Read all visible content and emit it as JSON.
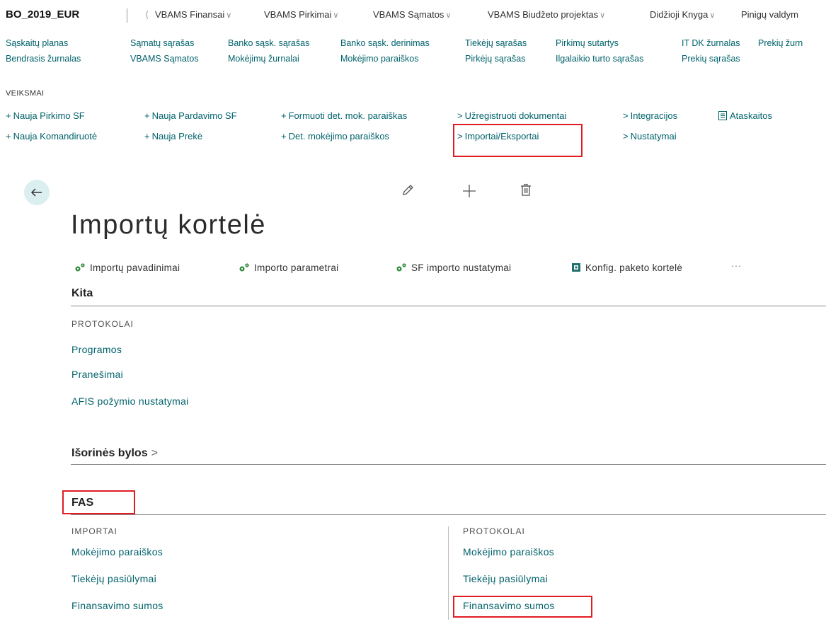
{
  "topnav": {
    "company": "BO_2019_EUR",
    "left_chevron": "⟨",
    "items": [
      {
        "label": "VBAMS Finansai"
      },
      {
        "label": "VBAMS Pirkimai"
      },
      {
        "label": "VBAMS Sąmatos"
      },
      {
        "label": "VBAMS Biudžeto projektas"
      },
      {
        "label": "Didžioji Knyga"
      },
      {
        "label": "Pinigų valdym"
      }
    ]
  },
  "quicklinks": {
    "row1": [
      "Sąskaitų planas",
      "Sąmatų sąrašas",
      "Banko sąsk. sąrašas",
      "Banko sąsk. derinimas",
      "Tiekėjų sąrašas",
      "Pirkimų sutartys",
      "IT DK žurnalas",
      "Prekių žurn"
    ],
    "row2": [
      "Bendrasis žurnalas",
      "VBAMS Sąmatos",
      "Mokėjimų žurnalai",
      "Mokėjimo paraiškos",
      "Pirkėjų sąrašas",
      "Ilgalaikio turto sąrašas",
      "Prekių sąrašas"
    ]
  },
  "actions": {
    "heading": "VEIKSMAI",
    "row1": [
      {
        "glyph": "+",
        "label": "Nauja Pirkimo SF"
      },
      {
        "glyph": "+",
        "label": "Nauja Pardavimo SF"
      },
      {
        "glyph": "+",
        "label": "Formuoti det. mok. paraiškas"
      },
      {
        "glyph": ">",
        "label": "Užregistruoti dokumentai"
      },
      {
        "glyph": ">",
        "label": "Integracijos"
      },
      {
        "glyph": "",
        "label": "Ataskaitos"
      }
    ],
    "row2": [
      {
        "glyph": "+",
        "label": "Nauja Komandiruotė"
      },
      {
        "glyph": "+",
        "label": "Nauja Prekė"
      },
      {
        "glyph": "+",
        "label": "Det. mokėjimo paraiškos"
      },
      {
        "glyph": ">",
        "label": "Importai/Eksportai"
      },
      {
        "glyph": ">",
        "label": "Nustatymai"
      }
    ]
  },
  "page": {
    "title": "Importų kortelė",
    "toolbar": [
      "Importų pavadinimai",
      "Importo parametrai",
      "SF importo nustatymai",
      "Konfig. paketo kortelė",
      "···"
    ],
    "sections": {
      "kita": {
        "title": "Kita",
        "group_heading": "PROTOKOLAI",
        "links": [
          "Programos",
          "Pranešimai",
          "AFIS požymio nustatymai"
        ]
      },
      "isorines": {
        "title": "Išorinės bylos",
        "chevron": ">"
      },
      "fas": {
        "title": "FAS",
        "importai": {
          "heading": "IMPORTAI",
          "links": [
            "Mokėjimo paraiškos",
            "Tiekėjų pasiūlymai",
            "Finansavimo sumos"
          ]
        },
        "protokolai": {
          "heading": "PROTOKOLAI",
          "links": [
            "Mokėjimo paraiškos",
            "Tiekėjų pasiūlymai",
            "Finansavimo sumos"
          ]
        }
      }
    }
  },
  "colors": {
    "accent": "#00626b",
    "highlight": "#e21c23",
    "back_button_bg": "#dbeef0"
  }
}
